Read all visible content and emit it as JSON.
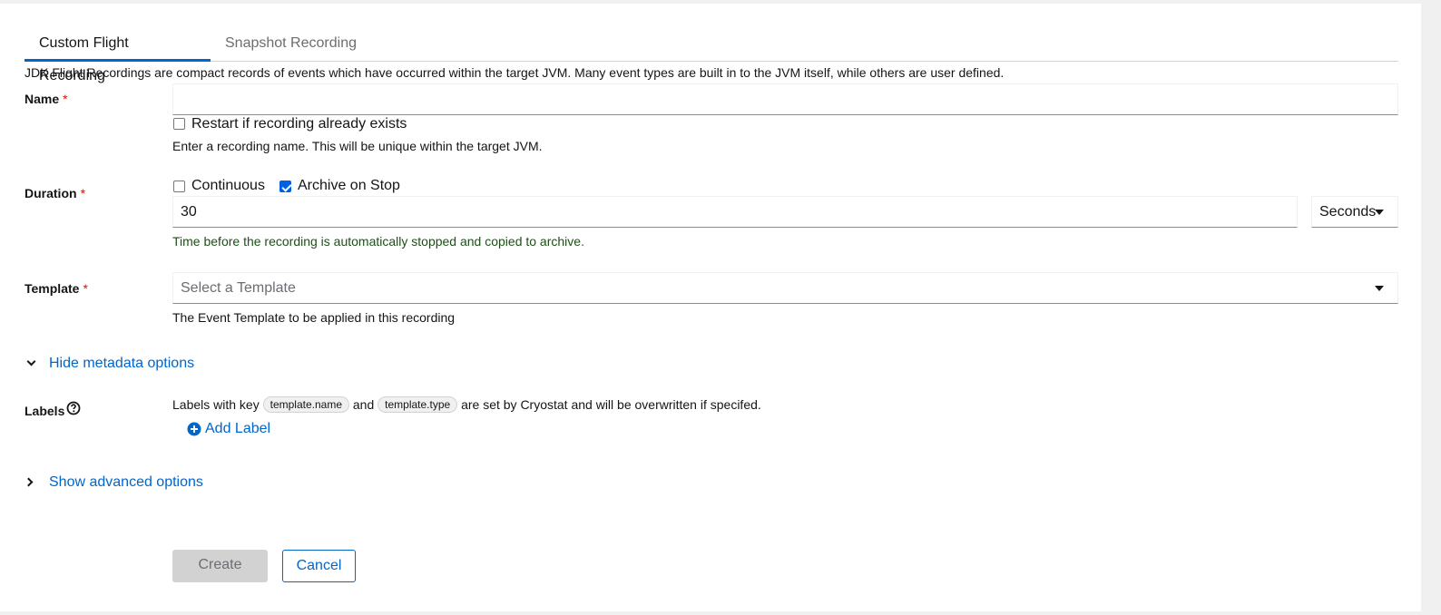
{
  "tabs": [
    {
      "label": "Custom Flight Recording",
      "active": true
    },
    {
      "label": "Snapshot Recording",
      "active": false
    }
  ],
  "description": "JDK Flight Recordings are compact records of events which have occurred within the target JVM. Many event types are built in to the JVM itself, while others are user defined.",
  "required_marker": "*",
  "name_field": {
    "label": "Name",
    "value": "",
    "restart_checkbox": {
      "label": "Restart if recording already exists",
      "checked": false
    },
    "helper": "Enter a recording name. This will be unique within the target JVM."
  },
  "duration_field": {
    "label": "Duration",
    "continuous_checkbox": {
      "label": "Continuous",
      "checked": false
    },
    "archive_checkbox": {
      "label": "Archive on Stop",
      "checked": true
    },
    "value": "30",
    "unit_select": "Seconds",
    "helper": "Time before the recording is automatically stopped and copied to archive."
  },
  "template_field": {
    "label": "Template",
    "placeholder": "Select a Template",
    "helper": "The Event Template to be applied in this recording"
  },
  "metadata_toggle": "Hide metadata options",
  "labels_field": {
    "label": "Labels",
    "help_prefix": "Labels with key",
    "chip1": "template.name",
    "and": "and",
    "chip2": "template.type",
    "help_suffix": "are set by Cryostat and will be overwritten if specifed.",
    "add_label": "Add Label"
  },
  "advanced_toggle": "Show advanced options",
  "actions": {
    "create": "Create",
    "cancel": "Cancel"
  },
  "colors": {
    "accent": "#0066cc",
    "required": "#c9190b",
    "success": "#1e4f18",
    "checkbox_checked": "#0060df"
  }
}
